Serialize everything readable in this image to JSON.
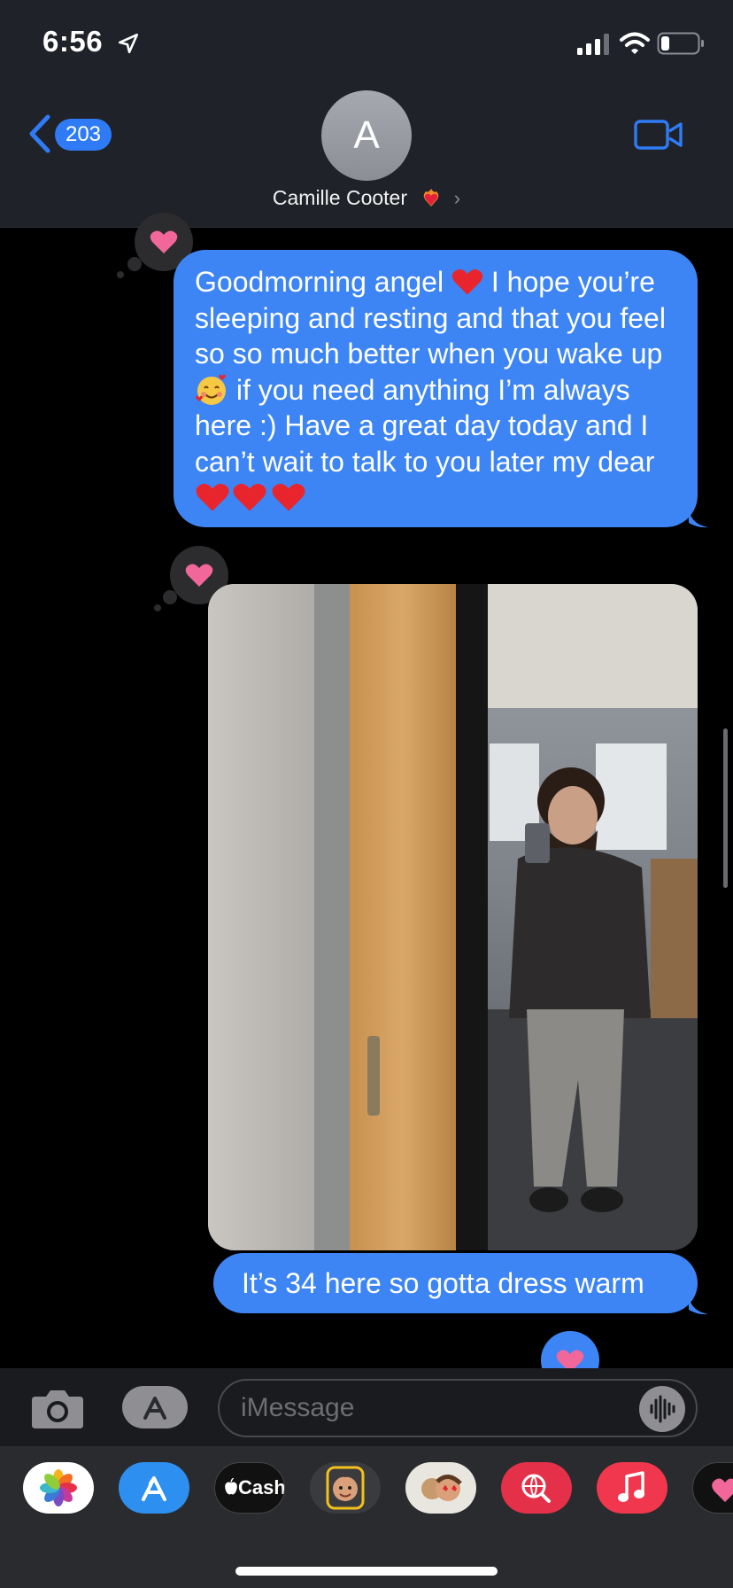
{
  "status_bar": {
    "time": "6:56"
  },
  "header": {
    "back_count": "203",
    "avatar_initial": "A",
    "contact_name": "Camille Cooter",
    "chevron": "›"
  },
  "conversation": {
    "message_1": {
      "parts": [
        "Goodmorning angel ",
        " I hope you’re sleeping and resting and that you feel so so much better when you wake up ",
        " if you need anything I’m always here :) Have a great day today and I can’t wait to talk to you later my dear "
      ],
      "reaction": "heart"
    },
    "message_2": {
      "type": "photo",
      "description_icon": "mirror-selfie-photo",
      "reaction": "heart"
    },
    "message_3": {
      "text": "It’s 34 here so gotta dress warm"
    }
  },
  "input_bar": {
    "placeholder": "iMessage"
  },
  "app_drawer": {
    "apps": [
      "photos",
      "app-store",
      "apple-cash",
      "memoji-stickers",
      "animoji",
      "web-images",
      "music",
      "digital-touch"
    ],
    "cash_label": "Cash"
  },
  "colors": {
    "bubble_blue": "#3d85f5",
    "header_bg": "#1f2228",
    "tapback_bg": "#2c2c2e",
    "heart_pink": "#f2679a"
  }
}
